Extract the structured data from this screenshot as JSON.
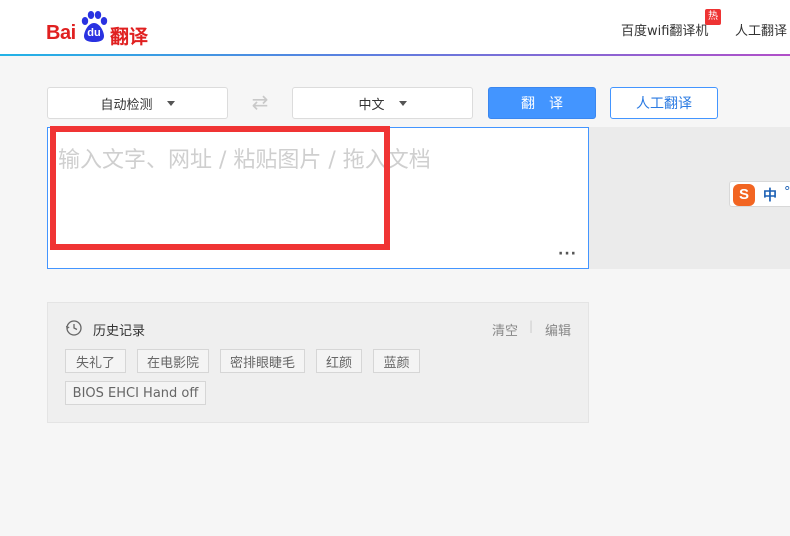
{
  "header": {
    "logo_text_bai": "Bai",
    "logo_text_du": "du",
    "logo_text_fanyi": "翻译",
    "nav_wifi": "百度wifi翻译机",
    "hot_badge": "热",
    "nav_human": "人工翻译",
    "accent_gradient": [
      "#22b3e6",
      "#5b7fe0",
      "#b14fc8"
    ]
  },
  "toolbar": {
    "source_lang": "自动检测",
    "target_lang": "中文",
    "swap_icon": "⇄",
    "translate_label": "翻译",
    "human_label": "人工翻译"
  },
  "input": {
    "placeholder": "输入文字、网址 / 粘贴图片 / 拖入文档",
    "more_label": "···"
  },
  "sogou": {
    "s_label": "S",
    "zh_label": "中",
    "dot_label": "°"
  },
  "history": {
    "title": "历史记录",
    "clear_label": "清空",
    "separator": "|",
    "edit_label": "编辑",
    "items": [
      "失礼了",
      "在电影院",
      "密排眼睫毛",
      "红颜",
      "蓝颜",
      "BIOS EHCI Hand off"
    ]
  },
  "colors": {
    "brand_red": "#e02020",
    "primary_blue": "#4395ff",
    "highlight_red": "#f03434"
  }
}
